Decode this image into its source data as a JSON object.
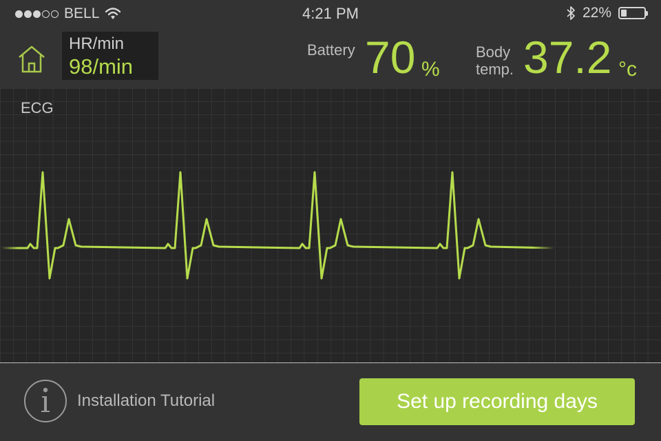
{
  "status_bar": {
    "carrier": "BELL",
    "signal_bars_filled": 3,
    "signal_bars_total": 5,
    "time": "4:21 PM",
    "battery_percent": "22%",
    "battery_level": 0.22,
    "icons": [
      "wifi-icon",
      "bluetooth-icon",
      "battery-icon"
    ]
  },
  "header": {
    "home_icon": "home-icon",
    "heart_rate": {
      "label": "HR/min",
      "value": "98/min"
    },
    "battery": {
      "label": "Battery",
      "value": "70",
      "unit": "%"
    },
    "body_temp": {
      "label_line1": "Body",
      "label_line2": "temp.",
      "value": "37.2",
      "unit": "°c"
    }
  },
  "ecg": {
    "label": "ECG"
  },
  "footer": {
    "info_icon": "info-icon",
    "tutorial_label": "Installation Tutorial",
    "cta_label": "Set up recording days"
  },
  "colors": {
    "accent": "#b6dc4c",
    "cta": "#a9d24a",
    "background": "#333333",
    "ecg_background": "#262626"
  }
}
